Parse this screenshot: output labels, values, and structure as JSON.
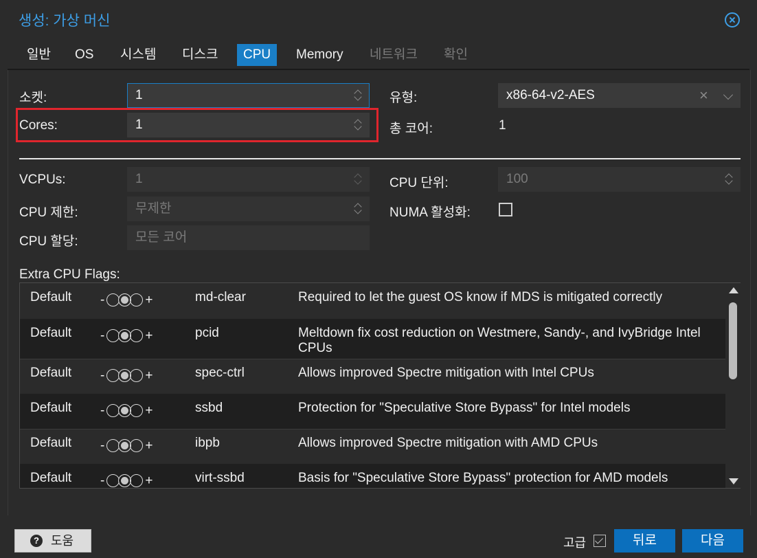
{
  "window": {
    "title": "생성: 가상 머신"
  },
  "tabs": [
    {
      "label": "일반",
      "state": "normal"
    },
    {
      "label": "OS",
      "state": "normal"
    },
    {
      "label": "시스템",
      "state": "normal"
    },
    {
      "label": "디스크",
      "state": "normal"
    },
    {
      "label": "CPU",
      "state": "active"
    },
    {
      "label": "Memory",
      "state": "normal"
    },
    {
      "label": "네트워크",
      "state": "disabled"
    },
    {
      "label": "확인",
      "state": "disabled"
    }
  ],
  "form": {
    "sockets_label": "소켓:",
    "sockets_value": "1",
    "cores_label": "Cores:",
    "cores_value": "1",
    "type_label": "유형:",
    "type_value": "x86-64-v2-AES",
    "total_cores_label": "총 코어:",
    "total_cores_value": "1",
    "vcpus_label": "VCPUs:",
    "vcpus_value": "1",
    "cpu_units_label": "CPU 단위:",
    "cpu_units_placeholder": "100",
    "cpu_limit_label": "CPU 제한:",
    "cpu_limit_placeholder": "무제한",
    "numa_label": "NUMA 활성화:",
    "numa_checked": false,
    "cpu_affinity_label": "CPU 할당:",
    "cpu_affinity_placeholder": "모든 코어"
  },
  "flags": {
    "label": "Extra CPU Flags:",
    "minus": "-",
    "plus": "+",
    "rows": [
      {
        "state": "Default",
        "flag": "md-clear",
        "description": "Required to let the guest OS know if MDS is mitigated correctly"
      },
      {
        "state": "Default",
        "flag": "pcid",
        "description": "Meltdown fix cost reduction on Westmere, Sandy-, and IvyBridge Intel CPUs"
      },
      {
        "state": "Default",
        "flag": "spec-ctrl",
        "description": "Allows improved Spectre mitigation with Intel CPUs"
      },
      {
        "state": "Default",
        "flag": "ssbd",
        "description": "Protection for \"Speculative Store Bypass\" for Intel models"
      },
      {
        "state": "Default",
        "flag": "ibpb",
        "description": "Allows improved Spectre mitigation with AMD CPUs"
      },
      {
        "state": "Default",
        "flag": "virt-ssbd",
        "description": "Basis for \"Speculative Store Bypass\" protection for AMD models"
      }
    ]
  },
  "footer": {
    "help_label": "도움",
    "advanced_label": "고급",
    "advanced_checked": true,
    "back_label": "뒤로",
    "next_label": "다음"
  },
  "colors": {
    "accent": "#1a7fc7",
    "title": "#3d9ee6",
    "highlight": "#e0252d",
    "background": "#2b2b2b"
  },
  "icons": [
    "close-icon",
    "spinner-icon",
    "clear-icon",
    "chevron-down-icon",
    "help-icon",
    "checkbox-icon"
  ]
}
